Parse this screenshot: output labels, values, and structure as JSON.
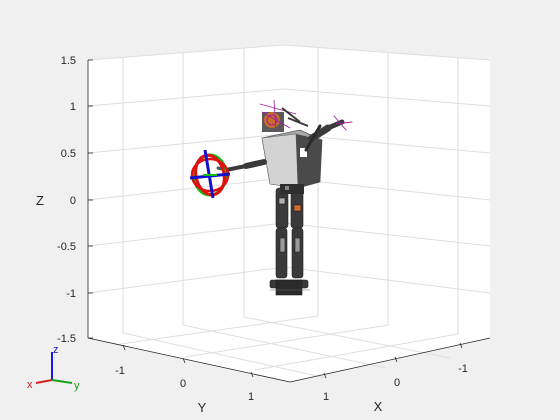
{
  "figure": {
    "background": "#f0f0f0",
    "axes_background": "#ffffff"
  },
  "axes": {
    "z_label": "Z",
    "x_label": "X",
    "y_label": "Y",
    "z_ticks": [
      "1.5",
      "1",
      "0.5",
      "0",
      "-0.5",
      "-1",
      "-1.5"
    ],
    "y_ticks": [
      "-1",
      "0",
      "1"
    ],
    "x_ticks": [
      "1",
      "0",
      "-1"
    ]
  },
  "triad": {
    "z_label": "z",
    "x_label": "x",
    "y_label": "y",
    "colors": {
      "x": "#d62020",
      "y": "#18a018",
      "z": "#1a1ad8"
    }
  },
  "robot": {
    "body_color": "#3a3a3a",
    "light_color": "#cfcfcf",
    "marker_colors": {
      "ring_red": "#e01010",
      "ring_green": "#10c010",
      "axis_blue": "#1010d0",
      "frame_magenta": "#a020a0",
      "head_orange": "#e07020"
    }
  }
}
